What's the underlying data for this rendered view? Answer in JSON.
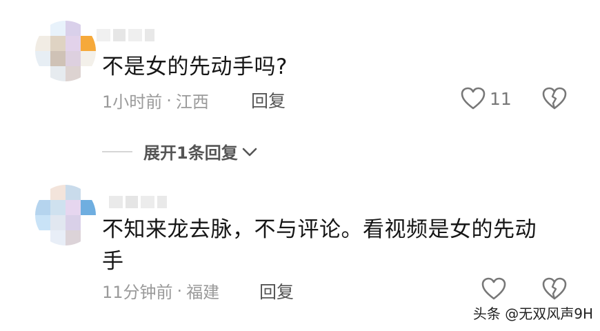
{
  "comments": [
    {
      "text": "不是女的先动手吗?",
      "time": "1小时前",
      "separator": "·",
      "location": "江西",
      "reply_label": "回复",
      "like_count": "11",
      "expand_line": "",
      "expand_label": "展开1条回复",
      "avatar_colors": [
        "#ffffff",
        "#e8f2fb",
        "#d9d0ea",
        "#ffffff",
        "#f1ece4",
        "#dfd3c3",
        "#e2d2ea",
        "#f6a93a",
        "#e7eef4",
        "#cfc2b6",
        "#ddd0df",
        "#f3f0ea",
        "#ffffff",
        "#e6ebef",
        "#ddd3d1",
        "#ffffff"
      ],
      "name_colors": [
        "#f0f0f0",
        "#e6e6e6",
        "#efefef",
        "#e8e8e8"
      ]
    },
    {
      "text": "不知来龙去脉，不与评论。看视频是女的先动手",
      "time": "11分钟前",
      "separator": "·",
      "location": "福建",
      "reply_label": "回复",
      "avatar_colors": [
        "#ffffff",
        "#f3e4db",
        "#c9dbeb",
        "#ffffff",
        "#b5d4ee",
        "#cfe1ef",
        "#e6d6ef",
        "#6faee0",
        "#c9e3f7",
        "#e1e7f0",
        "#d9d0e8",
        "#ffffff",
        "#ffffff",
        "#e8eef7",
        "#dcd3d8",
        "#ffffff"
      ],
      "name_colors": [
        "#eaeaea",
        "#e5e5e5",
        "#ececec",
        "#e9e9e9"
      ]
    }
  ],
  "watermark": "头条 @无双风声9H",
  "icons": {
    "like": "heart-outline-icon",
    "dislike": "broken-heart-icon",
    "expand": "chevron-down-icon"
  }
}
